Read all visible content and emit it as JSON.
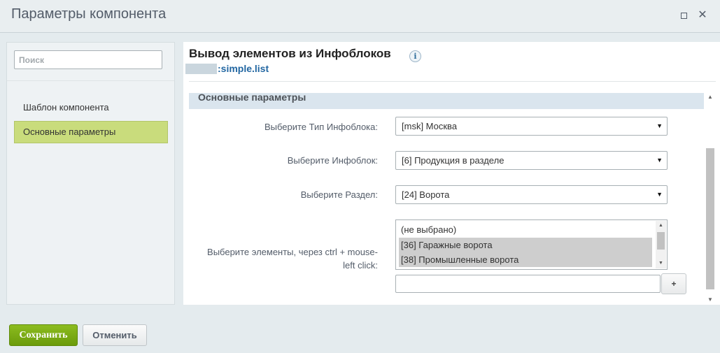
{
  "dialog": {
    "title": "Параметры компонента"
  },
  "sidebar": {
    "search_placeholder": "Поиск",
    "items": [
      {
        "label": "Шаблон компонента",
        "active": false
      },
      {
        "label": "Основные параметры",
        "active": true
      }
    ]
  },
  "content": {
    "title": "Вывод элементов из Инфоблоков",
    "template": ":simple.list",
    "section": "Основные параметры",
    "fields": {
      "iblock_type": {
        "label": "Выберите Тип Инфоблока:",
        "value": "[msk] Москва"
      },
      "iblock": {
        "label": "Выберите Инфоблок:",
        "value": "[6] Продукция в разделе"
      },
      "section": {
        "label": "Выберите Раздел:",
        "value": "[24] Ворота"
      },
      "elements": {
        "label_line1": "Выберите элементы, через ctrl + mouse-",
        "label_line2": "left click:",
        "options": [
          {
            "label": "(не выбрано)",
            "selected": false
          },
          {
            "label": "[36] Гаражные ворота",
            "selected": true
          },
          {
            "label": "[38] Промышленные ворота",
            "selected": true
          }
        ],
        "add_label": "+"
      }
    }
  },
  "footer": {
    "save_label": "Сохранить",
    "cancel_label": "Отменить"
  },
  "colors": {
    "accent_green": "#7aab13",
    "active_item": "#c9dc7c",
    "section_bg": "#dae5ee",
    "link_blue": "#2367a2"
  }
}
